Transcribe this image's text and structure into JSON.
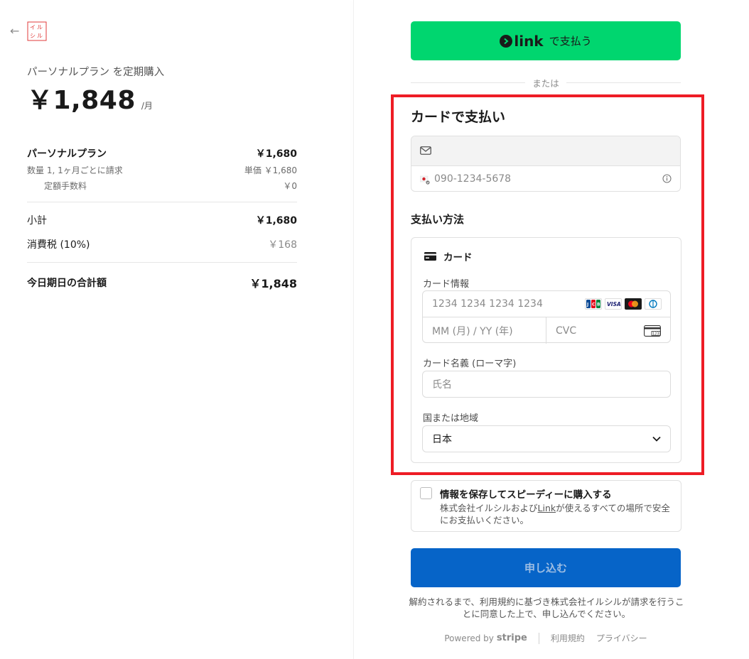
{
  "summary": {
    "plan_title": "パーソナルプラン を定期購入",
    "price": "￥1,848",
    "per": "/月",
    "item_name": "パーソナルプラン",
    "item_amount": "￥1,680",
    "item_qty": "数量 1, 1ヶ月ごとに請求",
    "item_unit_price": "単価 ￥1,680",
    "fee_label": "定額手数料",
    "fee_amount": "￥0",
    "subtotal_label": "小計",
    "subtotal_amount": "￥1,680",
    "tax_label": "消費税 (10%)",
    "tax_amount": "￥168",
    "total_label": "今日期日の合計額",
    "total_amount": "￥1,848"
  },
  "checkout": {
    "link_brand": "link",
    "link_pay_label": "で支払う",
    "or_label": "または",
    "card_section_title": "カードで支払い",
    "phone_placeholder": "090-1234-5678",
    "method_title": "支払い方法",
    "method_card_label": "カード",
    "card_info_label": "カード情報",
    "card_number_placeholder": "1234 1234 1234 1234",
    "expiry_placeholder": "MM (月) / YY (年)",
    "cvc_placeholder": "CVC",
    "name_label": "カード名義 (ローマ字)",
    "name_placeholder": "氏名",
    "country_label": "国または地域",
    "country_value": "日本",
    "save_title": "情報を保存してスピーディーに購入する",
    "save_desc_pre": "株式会社イルシルおよび",
    "save_desc_link": "Link",
    "save_desc_post": "が使えるすべての場所で安全にお支払いください。",
    "submit_label": "申し込む",
    "terms_text": "解約されるまで、利用規約に基づき株式会社イルシルが請求を行うことに同意した上で、申し込んでください。",
    "powered_by": "Powered by",
    "stripe_word": "stripe",
    "terms_link": "利用規約",
    "privacy_link": "プライバシー"
  },
  "colors": {
    "link_green": "#00d66f",
    "submit_blue": "#0664c8",
    "highlight_red": "#ee1c25"
  },
  "icons": [
    "back-arrow-icon",
    "brand-logo-icon",
    "link-icon",
    "mail-icon",
    "japan-flag-icon",
    "info-icon",
    "card-icon",
    "jcb-icon",
    "visa-icon",
    "mastercard-icon",
    "diners-icon",
    "cvc-icon",
    "chevron-down-icon"
  ]
}
